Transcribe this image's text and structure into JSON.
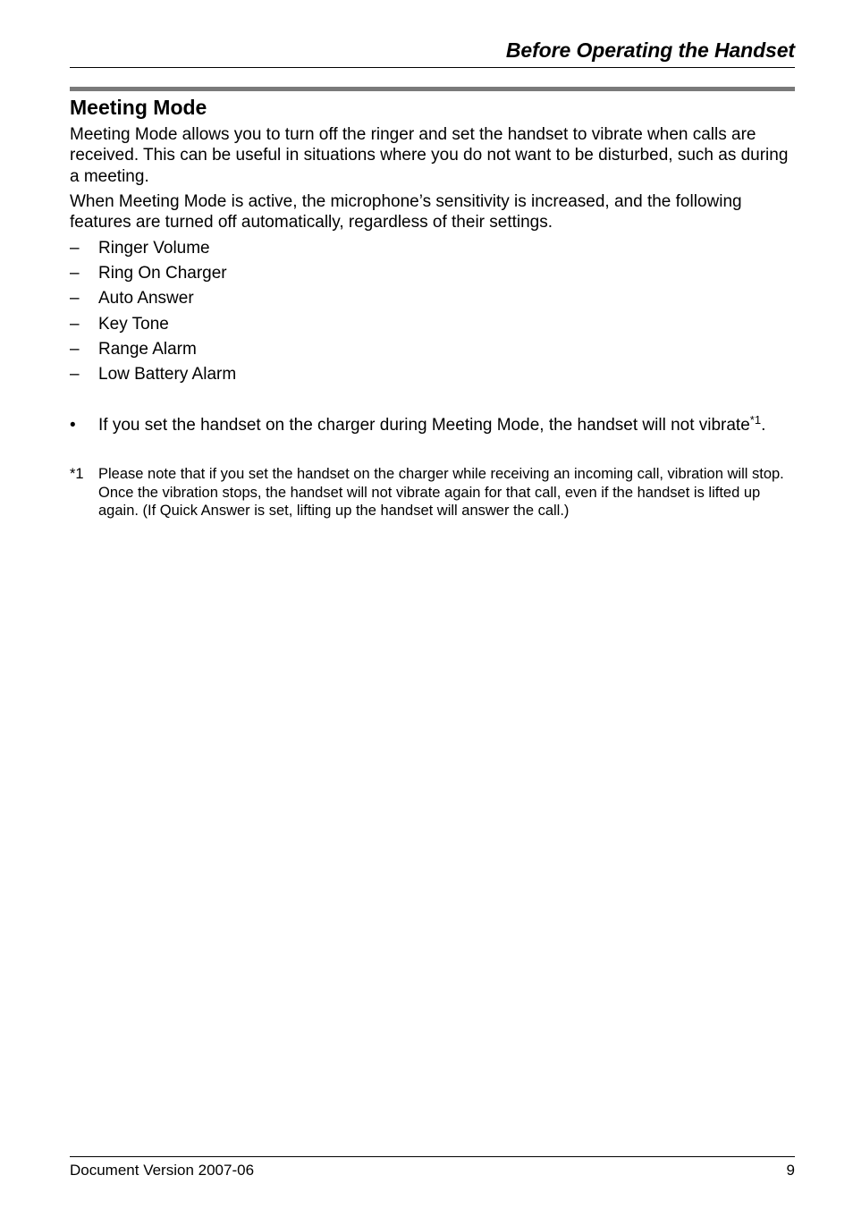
{
  "header": {
    "running_title": "Before Operating the Handset"
  },
  "section": {
    "title": "Meeting Mode",
    "paragraphs": [
      "Meeting Mode allows you to turn off the ringer and set the handset to vibrate when calls are received. This can be useful in situations where you do not want to be disturbed, such as during a meeting.",
      "When Meeting Mode is active, the microphone’s sensitivity is increased, and the following features are turned off automatically, regardless of their settings."
    ],
    "list_marker": "–",
    "disabled_features": [
      "Ringer Volume",
      "Ring On Charger",
      "Auto Answer",
      "Key Tone",
      "Range Alarm",
      "Low Battery Alarm"
    ],
    "note": {
      "marker": "•",
      "text": "If you set the handset on the charger during Meeting Mode, the handset will not vibrate",
      "footnote_ref": "*1",
      "end": "."
    },
    "footnote": {
      "marker": "*1",
      "text": "Please note that if you set the handset on the charger while receiving an incoming call, vibration will stop. Once the vibration stops, the handset will not vibrate again for that call, even if the handset is lifted up again. (If Quick Answer is set, lifting up the handset will answer the call.)"
    }
  },
  "footer": {
    "document_version": "Document Version 2007-06",
    "page_number": "9"
  },
  "colors": {
    "text": "#000000",
    "section_bar": "#7a7a7a",
    "background": "#ffffff"
  }
}
